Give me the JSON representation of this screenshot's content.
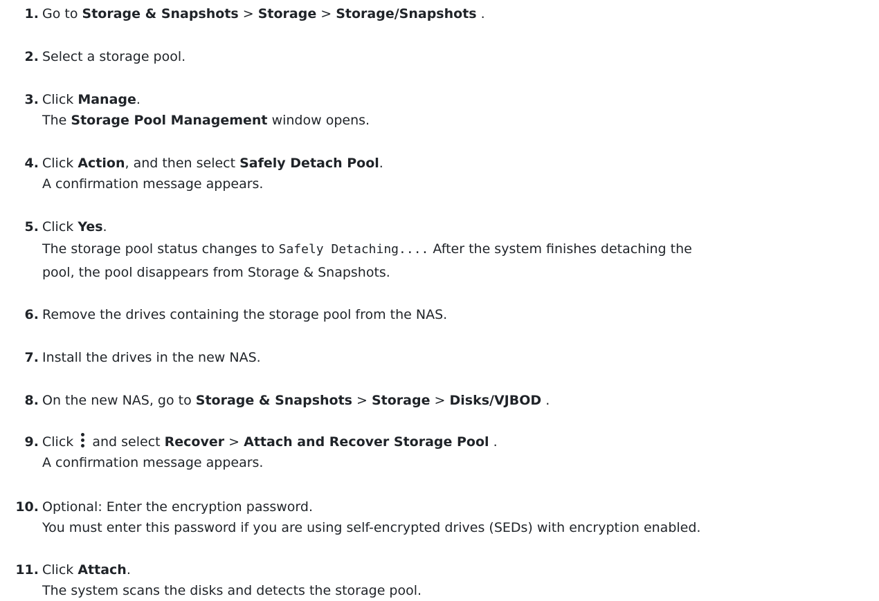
{
  "steps": [
    {
      "number": "1.",
      "segments": [
        {
          "t": "Go to "
        },
        {
          "t": "Storage & Snapshots",
          "b": true
        },
        {
          "t": " > "
        },
        {
          "t": "Storage",
          "b": true
        },
        {
          "t": " > "
        },
        {
          "t": "Storage/Snapshots",
          "b": true
        },
        {
          "t": " ."
        }
      ]
    },
    {
      "number": "2.",
      "segments": [
        {
          "t": "Select a storage pool."
        }
      ]
    },
    {
      "number": "3.",
      "segments": [
        {
          "t": "Click "
        },
        {
          "t": "Manage",
          "b": true
        },
        {
          "t": "."
        }
      ]
    },
    {
      "number": "3.sub",
      "segments": [
        {
          "t": "The "
        },
        {
          "t": "Storage Pool Management",
          "b": true
        },
        {
          "t": " window opens."
        }
      ]
    },
    {
      "number": "4.",
      "segments": [
        {
          "t": "Click "
        },
        {
          "t": "Action",
          "b": true
        },
        {
          "t": ", and then select "
        },
        {
          "t": "Safely Detach Pool",
          "b": true
        },
        {
          "t": "."
        }
      ]
    },
    {
      "number": "4.sub",
      "segments": [
        {
          "t": "A confirmation message appears."
        }
      ]
    },
    {
      "number": "5.",
      "segments": [
        {
          "t": "Click "
        },
        {
          "t": "Yes",
          "b": true
        },
        {
          "t": "."
        }
      ]
    },
    {
      "number": "5.sub1",
      "segments": [
        {
          "t": "The storage pool status changes to "
        },
        {
          "t": "Safely Detaching....",
          "m": true
        },
        {
          "t": " After the system finishes detaching the"
        }
      ]
    },
    {
      "number": "5.sub2",
      "segments": [
        {
          "t": "pool, the pool disappears from Storage & Snapshots."
        }
      ]
    },
    {
      "number": "6.",
      "segments": [
        {
          "t": "Remove the drives containing the storage pool from the NAS."
        }
      ]
    },
    {
      "number": "7.",
      "segments": [
        {
          "t": "Install the drives in the new NAS."
        }
      ]
    },
    {
      "number": "8.",
      "segments": [
        {
          "t": "On the new NAS, go to "
        },
        {
          "t": "Storage & Snapshots",
          "b": true
        },
        {
          "t": " > "
        },
        {
          "t": "Storage",
          "b": true
        },
        {
          "t": " > "
        },
        {
          "t": "Disks/VJBOD",
          "b": true
        },
        {
          "t": " ."
        }
      ]
    },
    {
      "number": "9.",
      "segments": [
        {
          "t": "Click "
        },
        {
          "icon": "kebab-icon"
        },
        {
          "t": " and select "
        },
        {
          "t": "Recover",
          "b": true
        },
        {
          "t": " > "
        },
        {
          "t": "Attach and Recover Storage Pool",
          "b": true
        },
        {
          "t": " ."
        }
      ]
    },
    {
      "number": "9.sub",
      "segments": [
        {
          "t": "A confirmation message appears."
        }
      ]
    },
    {
      "number": "10.",
      "segments": [
        {
          "t": "Optional: Enter the encryption password."
        }
      ]
    },
    {
      "number": "10.sub",
      "segments": [
        {
          "t": "You must enter this password if you are using self-encrypted drives (SEDs) with encryption enabled."
        }
      ]
    },
    {
      "number": "11.",
      "segments": [
        {
          "t": "Click "
        },
        {
          "t": "Attach",
          "b": true
        },
        {
          "t": "."
        }
      ]
    },
    {
      "number": "11.sub",
      "segments": [
        {
          "t": "The system scans the disks and detects the storage pool."
        }
      ]
    }
  ]
}
